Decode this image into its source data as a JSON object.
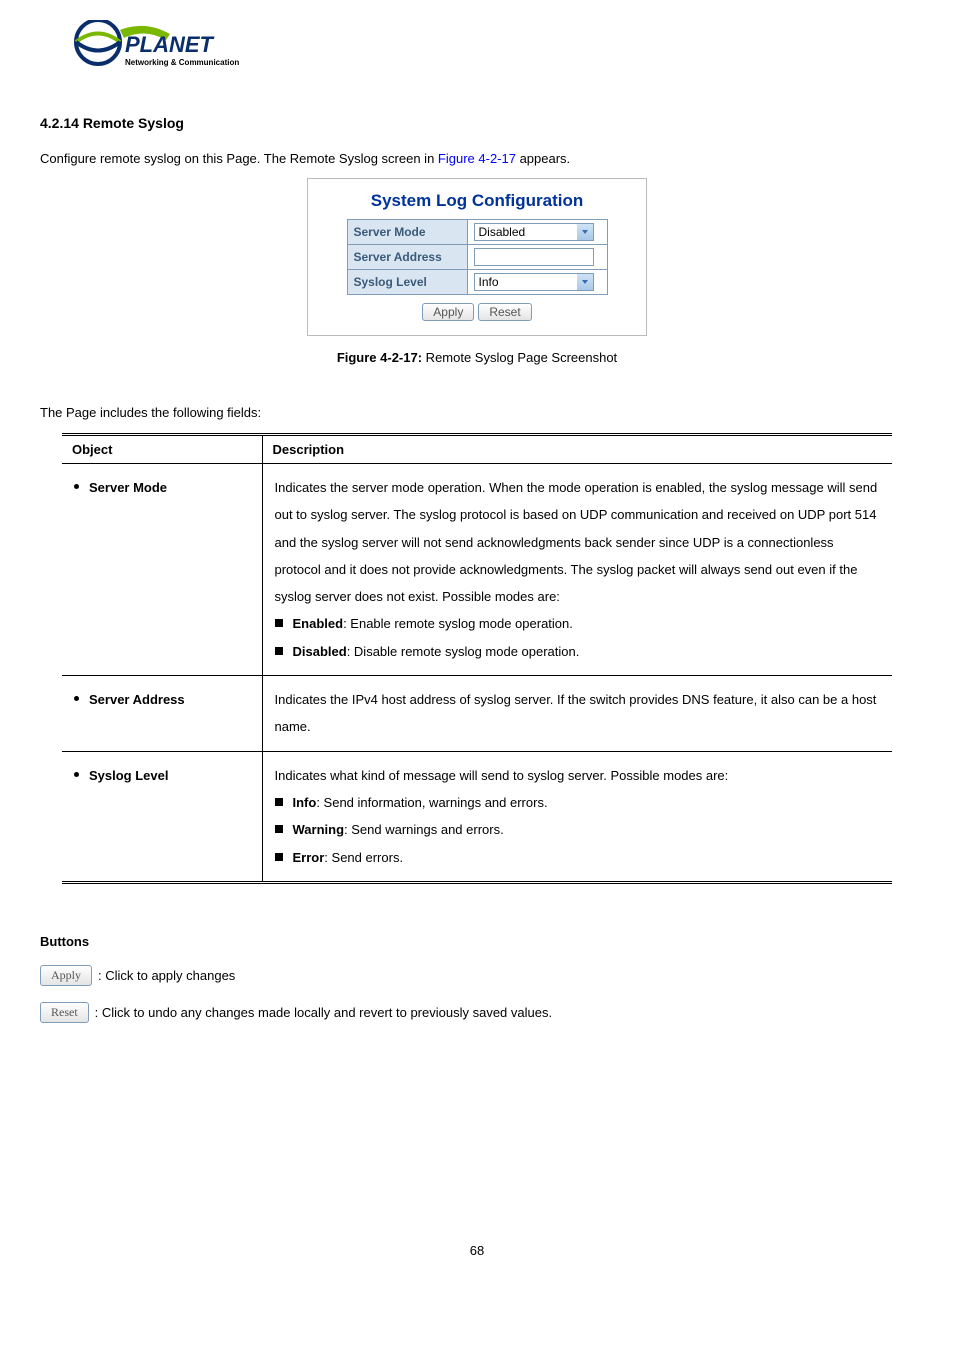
{
  "logo": {
    "brand": "PLANET",
    "tagline": "Networking & Communication"
  },
  "section_heading": "4.2.14 Remote Syslog",
  "intro_prefix": "Configure remote syslog on this Page. The Remote Syslog screen in ",
  "intro_figref": "Figure 4-2-17",
  "intro_suffix": " appears.",
  "screenshot": {
    "title": "System Log Configuration",
    "rows": {
      "server_mode": {
        "label": "Server Mode",
        "value": "Disabled"
      },
      "server_address": {
        "label": "Server Address",
        "value": ""
      },
      "syslog_level": {
        "label": "Syslog Level",
        "value": "Info"
      }
    },
    "apply": "Apply",
    "reset": "Reset"
  },
  "caption_prefix": "Figure 4-2-17:",
  "caption_text": " Remote Syslog Page Screenshot",
  "fields_intro": "The Page includes the following fields:",
  "table": {
    "head_object": "Object",
    "head_desc": "Description",
    "rows": [
      {
        "object": "Server Mode",
        "desc": "Indicates the server mode operation. When the mode operation is enabled, the syslog message will send out to syslog server. The syslog protocol is based on UDP communication and received on UDP port 514 and the syslog server will not send acknowledgments back sender since UDP is a connectionless protocol and it does not provide acknowledgments. The syslog packet will always send out even if the syslog server does not exist. Possible modes are:",
        "items": [
          {
            "term": "Enabled",
            "text": ": Enable remote syslog mode operation."
          },
          {
            "term": "Disabled",
            "text": ": Disable remote syslog mode operation."
          }
        ]
      },
      {
        "object": "Server Address",
        "desc": "Indicates the IPv4 host address of syslog server. If the switch provides DNS feature, it also can be a host name.",
        "items": []
      },
      {
        "object": "Syslog Level",
        "desc": "Indicates what kind of message will send to syslog server. Possible modes are:",
        "items": [
          {
            "term": "Info",
            "text": ": Send information, warnings and errors."
          },
          {
            "term": "Warning",
            "text": ": Send warnings and errors."
          },
          {
            "term": "Error",
            "text": ": Send errors."
          }
        ]
      }
    ]
  },
  "buttons": {
    "heading": "Buttons",
    "apply_label": "Apply",
    "apply_desc": ": Click to apply changes",
    "reset_label": "Reset",
    "reset_desc": ": Click to undo any changes made locally and revert to previously saved values."
  },
  "page_number": "68"
}
